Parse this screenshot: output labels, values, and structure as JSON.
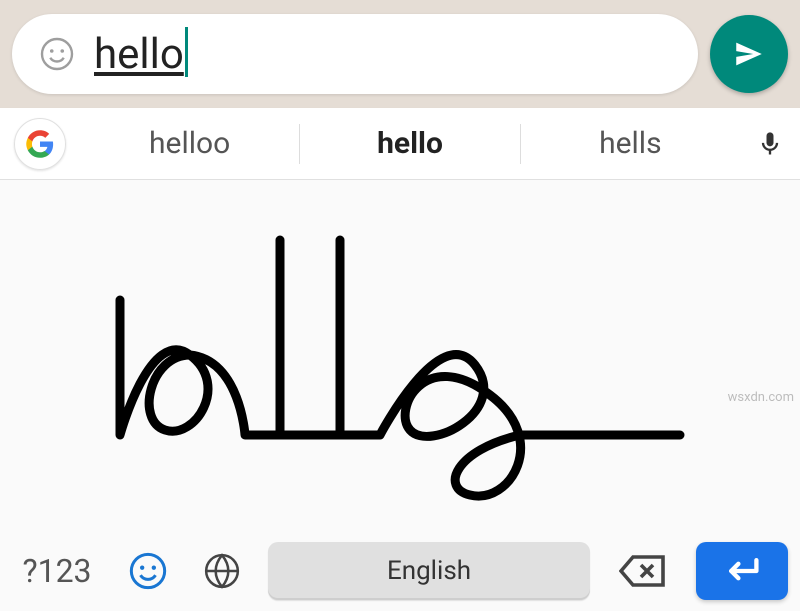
{
  "chat": {
    "input_value": "hello"
  },
  "suggestions": {
    "items": [
      "helloo",
      "hello",
      "hells"
    ],
    "selected_index": 1
  },
  "bottom": {
    "numeric_label": "?123",
    "space_label": "English"
  },
  "icons": {
    "emoji": "emoji-icon",
    "send": "send-icon",
    "google": "google-icon",
    "mic": "mic-icon",
    "face": "face-icon",
    "globe": "globe-icon",
    "backspace": "backspace-icon",
    "enter": "enter-icon"
  },
  "watermark": "wsxdn.com"
}
